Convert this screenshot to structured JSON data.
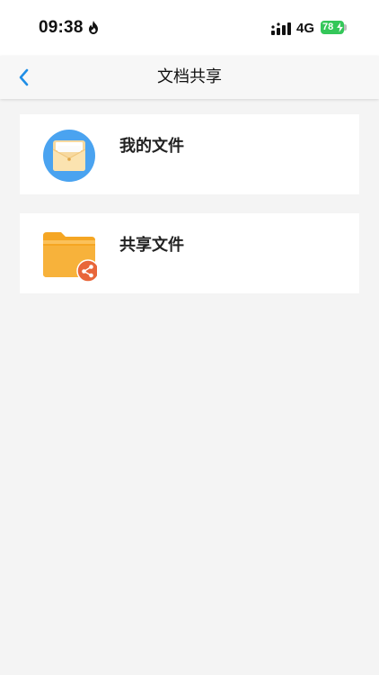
{
  "status_bar": {
    "time": "09:38",
    "network": "4G",
    "battery_level": "78",
    "icons": [
      "flame-icon",
      "signal-icon",
      "battery-icon",
      "charging-bolt-icon"
    ]
  },
  "nav": {
    "title": "文档共享",
    "back_icon": "chevron-left-icon"
  },
  "items": [
    {
      "label": "我的文件",
      "icon": "envelope-folder-icon"
    },
    {
      "label": "共享文件",
      "icon": "shared-folder-icon"
    }
  ],
  "colors": {
    "accent_blue": "#1f8ee6",
    "my_files_circle": "#4aa3f0",
    "folder_orange": "#f5a623",
    "share_badge": "#e8663a",
    "battery_green": "#34c759",
    "background": "#f4f4f4"
  }
}
